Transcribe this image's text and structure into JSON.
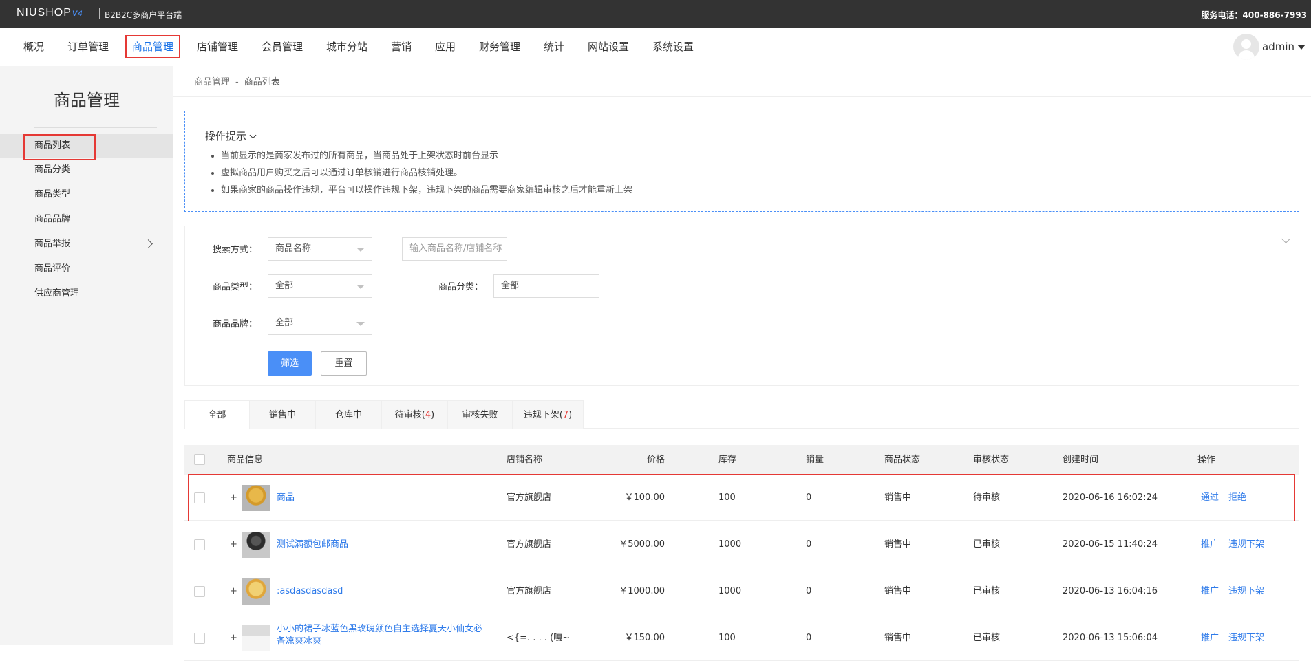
{
  "topbar": {
    "logo": "NIUSHOP",
    "logo_version": "V4",
    "platform": "B2B2C多商户平台端",
    "hotline": "服务电话：400-886-7993"
  },
  "nav": {
    "items": [
      "概况",
      "订单管理",
      "商品管理",
      "店铺管理",
      "会员管理",
      "城市分站",
      "营销",
      "应用",
      "财务管理",
      "统计",
      "网站设置",
      "系统设置"
    ],
    "active_index": 2,
    "user": "admin"
  },
  "sidebar": {
    "title": "商品管理",
    "items": [
      "商品列表",
      "商品分类",
      "商品类型",
      "商品品牌",
      "商品举报",
      "商品评价",
      "供应商管理"
    ],
    "active_index": 0
  },
  "breadcrumb": {
    "parent": "商品管理",
    "separator": "-",
    "current": "商品列表"
  },
  "tips": {
    "title": "操作提示",
    "lines": [
      "当前显示的是商家发布过的所有商品，当商品处于上架状态时前台显示",
      "虚拟商品用户购买之后可以通过订单核销进行商品核销处理。",
      "如果商家的商品操作违规，平台可以操作违规下架，违规下架的商品需要商家编辑审核之后才能重新上架"
    ]
  },
  "filter": {
    "search_label": "搜索方式：",
    "search_mode": "商品名称",
    "keyword_placeholder": "输入商品名称/店铺名称",
    "type_label": "商品类型：",
    "type_value": "全部",
    "category_label": "商品分类：",
    "category_value": "全部",
    "brand_label": "商品品牌：",
    "brand_value": "全部",
    "submit": "筛选",
    "reset": "重置"
  },
  "tabs": [
    {
      "label": "全部",
      "count": ""
    },
    {
      "label": "销售中",
      "count": ""
    },
    {
      "label": "仓库中",
      "count": ""
    },
    {
      "label": "待审核",
      "count": "4"
    },
    {
      "label": "审核失败",
      "count": ""
    },
    {
      "label": "违规下架",
      "count": "7"
    }
  ],
  "table": {
    "headers": {
      "info": "商品信息",
      "shop": "店铺名称",
      "price": "价格",
      "stock": "库存",
      "sales": "销量",
      "status": "商品状态",
      "audit": "审核状态",
      "created": "创建时间",
      "ops": "操作"
    },
    "rows": [
      {
        "name": "商品",
        "shop": "官方旗舰店",
        "price": "￥100.00",
        "stock": "100",
        "sales": "0",
        "status": "销售中",
        "audit": "待审核",
        "created": "2020-06-16 16:02:24",
        "op1": "通过",
        "op2": "拒绝",
        "highlight": true
      },
      {
        "name": "测试满额包邮商品",
        "shop": "官方旗舰店",
        "price": "￥5000.00",
        "stock": "1000",
        "sales": "0",
        "status": "销售中",
        "audit": "已审核",
        "created": "2020-06-15 11:40:24",
        "op1": "推广",
        "op2": "违规下架"
      },
      {
        "name": ":asdasdasdasd",
        "shop": "官方旗舰店",
        "price": "￥1000.00",
        "stock": "1000",
        "sales": "0",
        "status": "销售中",
        "audit": "已审核",
        "created": "2020-06-13 16:04:16",
        "op1": "推广",
        "op2": "违规下架"
      },
      {
        "name": "小小的裙子冰蓝色黑玫瑰颜色自主选择夏天小仙女必备凉爽冰爽",
        "shop": "<{=. . . . (嘎~",
        "price": "￥150.00",
        "stock": "100",
        "sales": "0",
        "status": "销售中",
        "audit": "已审核",
        "created": "2020-06-13 15:06:04",
        "op1": "推广",
        "op2": "违规下架"
      }
    ]
  },
  "colors": {
    "accent": "#4a8ff7",
    "link": "#2f7bea",
    "highlight_border": "#e53935",
    "topbar": "#333333"
  }
}
